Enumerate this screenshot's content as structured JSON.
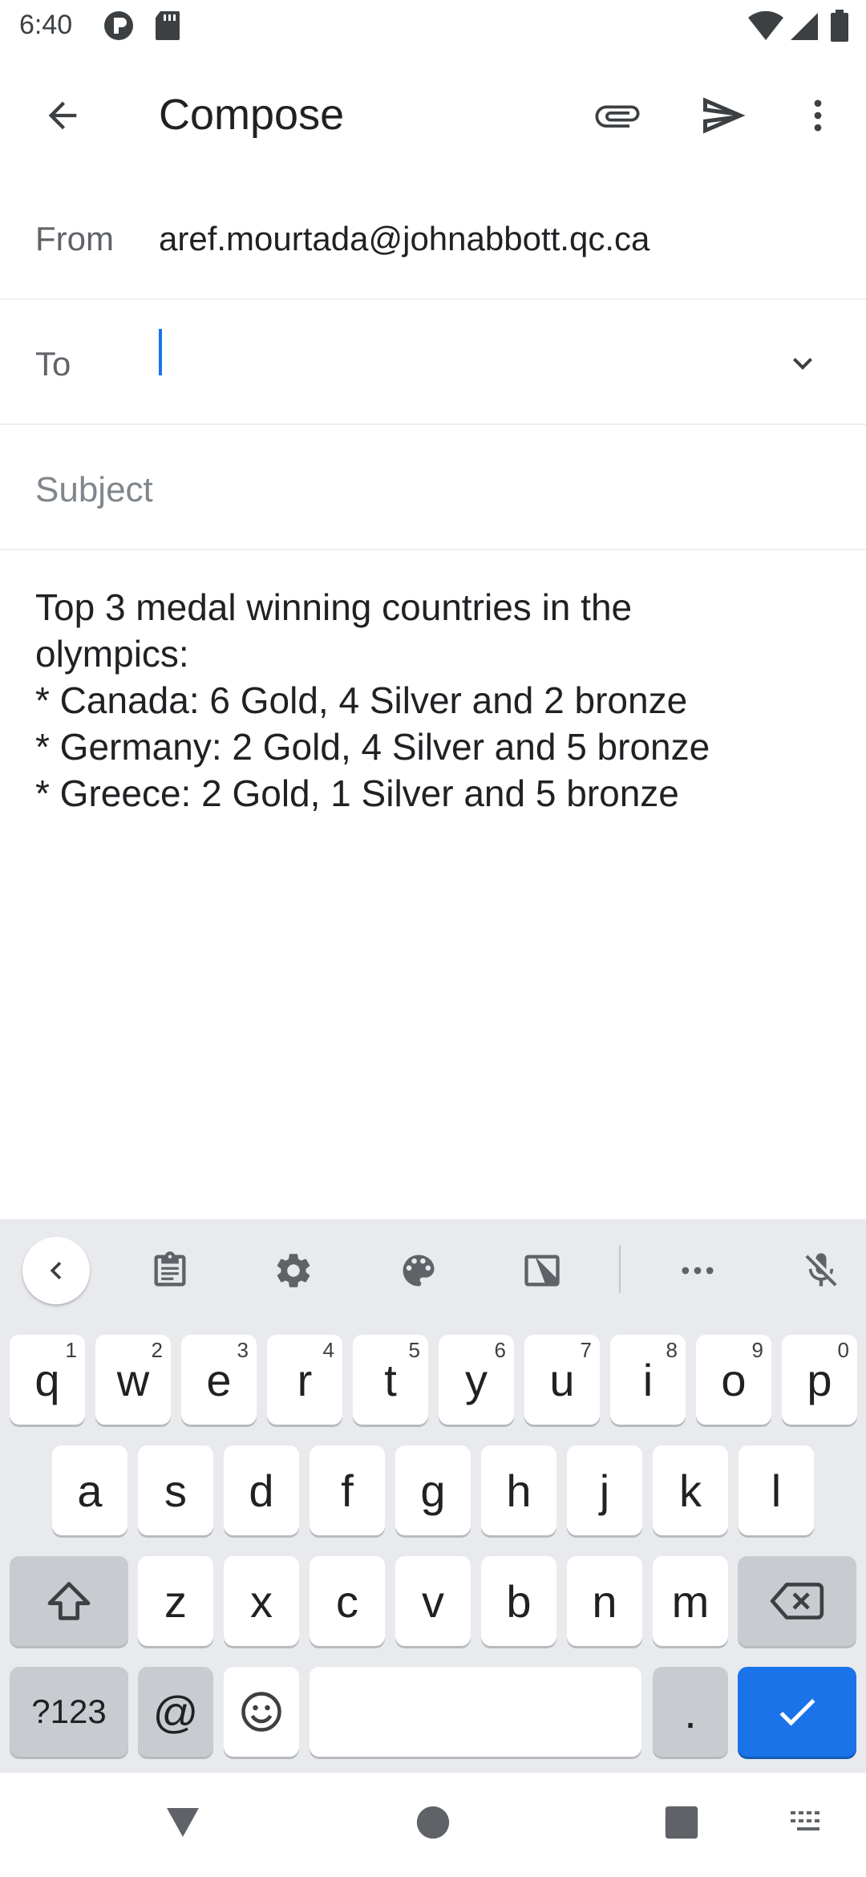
{
  "status_bar": {
    "time": "6:40"
  },
  "app_bar": {
    "title": "Compose",
    "icons": [
      "back-arrow-icon",
      "attachment-icon",
      "send-icon",
      "more-vert-icon"
    ]
  },
  "from_field": {
    "label": "From",
    "value": "aref.mourtada@johnabbott.qc.ca"
  },
  "to_field": {
    "label": "To",
    "value": ""
  },
  "subject_field": {
    "placeholder": "Subject"
  },
  "body": {
    "lines": [
      "Top 3 medal winning countries in the",
      "olympics:",
      "* Canada: 6 Gold, 4 Silver and 2 bronze",
      "* Germany: 2 Gold, 4 Silver and 5 bronze",
      "* Greece: 2 Gold, 1 Silver and 5 bronze"
    ]
  },
  "keyboard": {
    "toolbar_icons": [
      "chevron-left-icon",
      "clipboard-icon",
      "settings-icon",
      "palette-icon",
      "one-handed-icon",
      "more-horiz-icon",
      "mic-off-icon"
    ],
    "row1": [
      {
        "key": "q",
        "hint": "1"
      },
      {
        "key": "w",
        "hint": "2"
      },
      {
        "key": "e",
        "hint": "3"
      },
      {
        "key": "r",
        "hint": "4"
      },
      {
        "key": "t",
        "hint": "5"
      },
      {
        "key": "y",
        "hint": "6"
      },
      {
        "key": "u",
        "hint": "7"
      },
      {
        "key": "i",
        "hint": "8"
      },
      {
        "key": "o",
        "hint": "9"
      },
      {
        "key": "p",
        "hint": "0"
      }
    ],
    "row2": [
      "a",
      "s",
      "d",
      "f",
      "g",
      "h",
      "j",
      "k",
      "l"
    ],
    "row3": [
      "z",
      "x",
      "c",
      "v",
      "b",
      "n",
      "m"
    ],
    "symbols_label": "?123",
    "at_label": "@",
    "period_label": ".",
    "accent_color": "#1a73e8"
  },
  "nav_bar": {
    "icons": [
      "back-triangle-icon",
      "home-circle-icon",
      "recents-square-icon",
      "keyboard-switch-icon"
    ]
  }
}
